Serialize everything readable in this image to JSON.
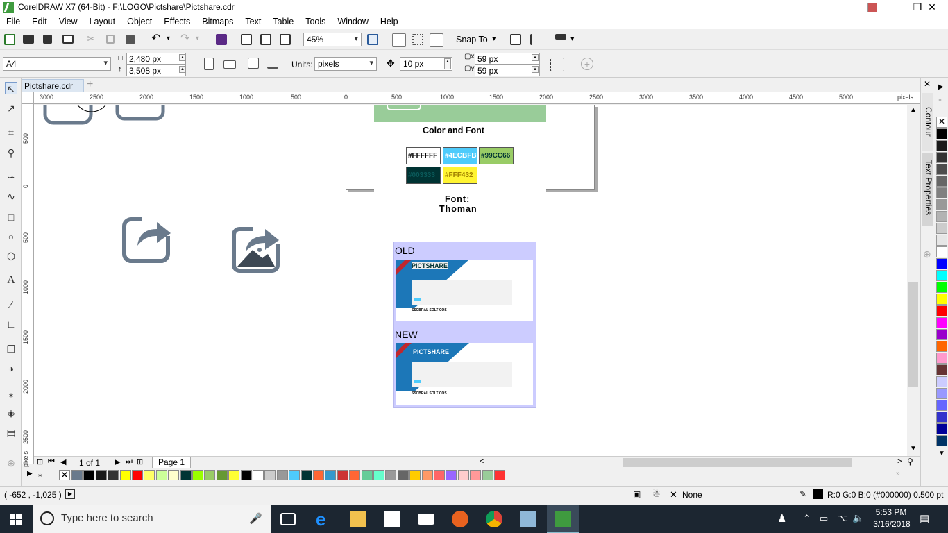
{
  "window": {
    "title": "CorelDRAW X7 (64-Bit) - F:\\LOGO\\Pictshare\\Pictshare.cdr"
  },
  "menu": [
    "File",
    "Edit",
    "View",
    "Layout",
    "Object",
    "Effects",
    "Bitmaps",
    "Text",
    "Table",
    "Tools",
    "Window",
    "Help"
  ],
  "toolbar": {
    "zoom": "45%",
    "snap_to": "Snap To"
  },
  "propbar": {
    "page_size": "A4",
    "width": "2,480 px",
    "height": "3,508 px",
    "units_label": "Units:",
    "units": "pixels",
    "nudge": "10 px",
    "dup_x": "59 px",
    "dup_y": "59 px"
  },
  "doc_tab": "Pictshare.cdr",
  "ruler": {
    "h_labels": [
      "3000",
      "2500",
      "2000",
      "1500",
      "1000",
      "500",
      "0",
      "500",
      "1000",
      "1500",
      "2000",
      "2500",
      "3000",
      "3500",
      "4000",
      "4500",
      "5000"
    ],
    "h_unit": "pixels",
    "v_labels": [
      "500",
      "0",
      "500",
      "1000",
      "1500",
      "2000",
      "2500"
    ],
    "v_unit": "pixels"
  },
  "canvas": {
    "color_font_title": "Color and Font",
    "swatches": [
      {
        "label": "#FFFFFF",
        "color": "#FFFFFF"
      },
      {
        "label": "#4ECBFB",
        "color": "#4ECBFB"
      },
      {
        "label": "#99CC66",
        "color": "#99CC66"
      },
      {
        "label": "#003333",
        "color": "#003333"
      },
      {
        "label": "#FFF432",
        "color": "#FFF432"
      }
    ],
    "font_label": "Font:",
    "font_name": "Thoman",
    "old_label": "OLD",
    "new_label": "NEW",
    "old_logo": "PICTSHARE",
    "new_logo": "PICTSHARE",
    "shot_footer": "SSCBRAL SOLT COS"
  },
  "dockers": [
    "Contour",
    "Text Properties"
  ],
  "pagebar": {
    "page_count": "1 of 1",
    "page_tab": "Page 1"
  },
  "status": {
    "coords": "( -652 , -1,025 )",
    "fill": "None",
    "outline": "R:0 G:0 B:0 (#000000)  0.500 pt"
  },
  "taskbar": {
    "search_placeholder": "Type here to search",
    "time": "5:53 PM",
    "date": "3/16/2018"
  },
  "palette_right": [
    "#ffffff",
    "#000000",
    "#1a1a1a",
    "#333333",
    "#4d4d4d",
    "#666666",
    "#808080",
    "#999999",
    "#b3b3b3",
    "#cccccc",
    "#e6e6e6",
    "#ffffff",
    "#0000ff",
    "#00ffff",
    "#00ff00",
    "#ffff00",
    "#ff0000",
    "#ff00ff",
    "#9900cc",
    "#ff6600",
    "#ff99cc",
    "#663333",
    "#ccccff",
    "#9999ff",
    "#6666ff",
    "#3333cc",
    "#000099",
    "#003366"
  ],
  "palette_bottom": [
    "#6a7a8c",
    "#000000",
    "#1a1a1a",
    "#333333",
    "#ffff00",
    "#ff0000",
    "#ffff66",
    "#ccff99",
    "#ffffcc",
    "#003333",
    "#99ff00",
    "#99cc66",
    "#669933",
    "#ffff33",
    "#000000",
    "#ffffff",
    "#cccccc",
    "#999999",
    "#4ecbfb",
    "#003333",
    "#ff6633",
    "#3399cc",
    "#cc3333",
    "#ff6633",
    "#66cc99",
    "#66ffcc",
    "#999999",
    "#666666",
    "#ffcc00",
    "#ff9966",
    "#ff6666",
    "#9966ff",
    "#ffcccc",
    "#ff9999",
    "#99cc99",
    "#ff3333"
  ]
}
